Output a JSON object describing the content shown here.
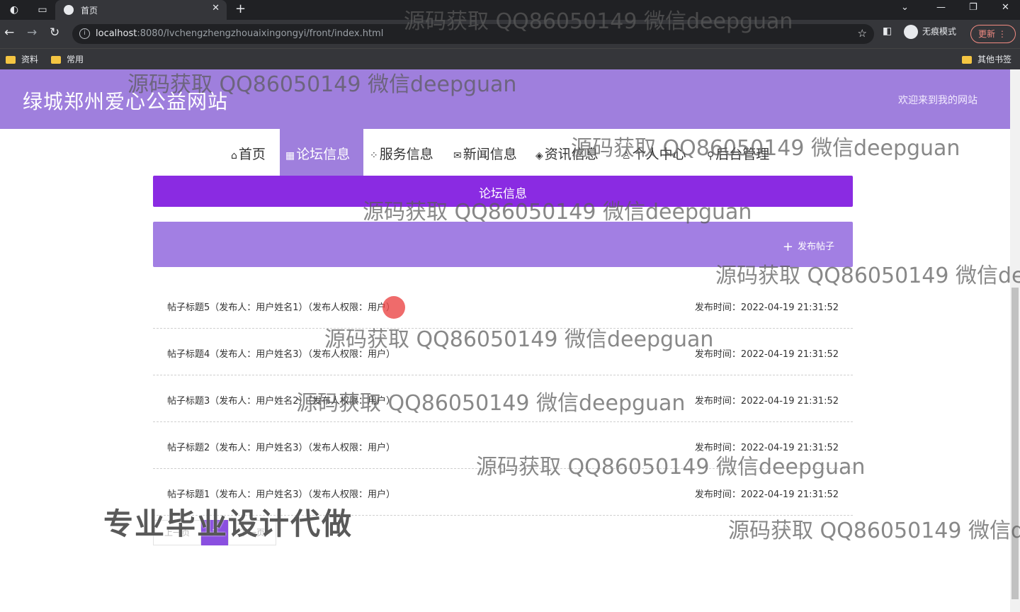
{
  "browser": {
    "tab_title": "首页",
    "url_host": "localhost",
    "url_path": ":8080/lvchengzhengzhouaixingongyi/front/index.html",
    "incognito_label": "无痕模式",
    "update_label": "更新",
    "bookmarks": [
      "资料",
      "常用"
    ],
    "other_bookmarks": "其他书签"
  },
  "site": {
    "title": "绿城郑州爱心公益网站",
    "welcome": "欢迎来到我的网站"
  },
  "nav": {
    "items": [
      {
        "label": "首页",
        "icon": "home-icon"
      },
      {
        "label": "论坛信息",
        "icon": "forum-icon"
      },
      {
        "label": "服务信息",
        "icon": "grid-icon"
      },
      {
        "label": "新闻信息",
        "icon": "mail-icon"
      },
      {
        "label": "资讯信息",
        "icon": "layers-icon"
      },
      {
        "label": "个人中心",
        "icon": "user-icon"
      },
      {
        "label": "后台管理",
        "icon": "link-icon"
      }
    ],
    "active_index": 1
  },
  "banner": {
    "title": "论坛信息"
  },
  "post_button": {
    "label": "发布帖子"
  },
  "posts": [
    {
      "title": "帖子标题5（发布人：用户姓名1）（发布人权限：用户）",
      "time": "发布时间：2022-04-19 21:31:52"
    },
    {
      "title": "帖子标题4（发布人：用户姓名3）（发布人权限：用户）",
      "time": "发布时间：2022-04-19 21:31:52"
    },
    {
      "title": "帖子标题3（发布人：用户姓名2）（发布人权限：用户）",
      "time": "发布时间：2022-04-19 21:31:52"
    },
    {
      "title": "帖子标题2（发布人：用户姓名3）（发布人权限：用户）",
      "time": "发布时间：2022-04-19 21:31:52"
    },
    {
      "title": "帖子标题1（发布人：用户姓名3）（发布人权限：用户）",
      "time": "发布时间：2022-04-19 21:31:52"
    }
  ],
  "pager": {
    "prev": "上一页",
    "current": "1",
    "next": "下一页"
  },
  "watermarks": {
    "qq": "源码获取 QQ86050149 微信deepguan",
    "big": "专业毕业设计代做"
  },
  "colors": {
    "header": "#9f7fdd",
    "banner": "#8a2be2",
    "postbar": "#a27fe3"
  }
}
